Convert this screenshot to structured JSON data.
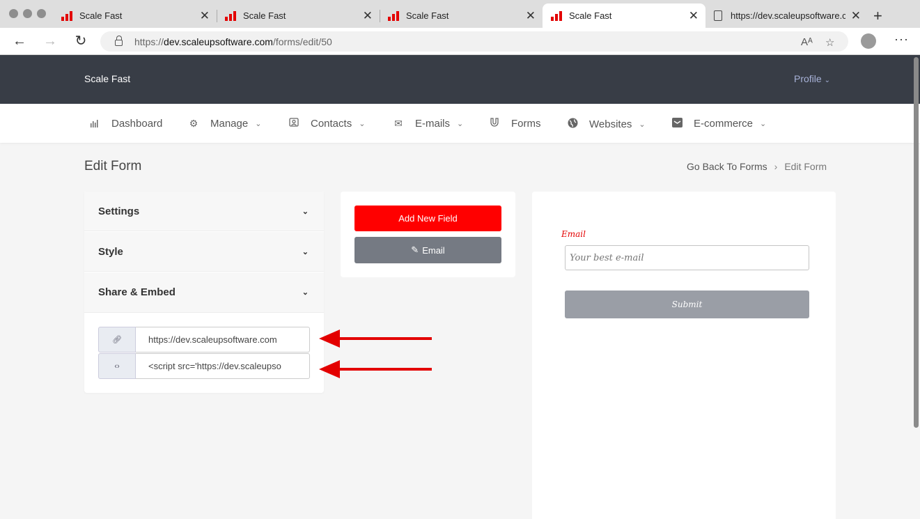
{
  "browser": {
    "tabs": [
      {
        "title": "Scale Fast",
        "active": false
      },
      {
        "title": "Scale Fast",
        "active": false
      },
      {
        "title": "Scale Fast",
        "active": false
      },
      {
        "title": "Scale Fast",
        "active": true
      },
      {
        "title": "https://dev.scaleupsoftware.c",
        "active": false
      }
    ],
    "url_host": "dev.scaleupsoftware.com",
    "url_scheme": "https://",
    "url_path": "/forms/edit/50"
  },
  "app": {
    "brand": "Scale Fast",
    "profile_label": "Profile",
    "menu": [
      {
        "label": "Dashboard",
        "icon": "chart-icon",
        "dropdown": false
      },
      {
        "label": "Manage",
        "icon": "gear-icon",
        "dropdown": true
      },
      {
        "label": "Contacts",
        "icon": "contact-icon",
        "dropdown": true
      },
      {
        "label": "E-mails",
        "icon": "mail-icon",
        "dropdown": true
      },
      {
        "label": "Forms",
        "icon": "magnet-icon",
        "dropdown": false
      },
      {
        "label": "Websites",
        "icon": "globe-icon",
        "dropdown": true
      },
      {
        "label": "E-commerce",
        "icon": "inbox-icon",
        "dropdown": true
      }
    ]
  },
  "page": {
    "title": "Edit Form",
    "breadcrumb": {
      "back": "Go Back To Forms",
      "current": "Edit Form"
    }
  },
  "accordion": {
    "settings": "Settings",
    "style": "Style",
    "share": "Share & Embed",
    "share_link": "https://dev.scaleupsoftware.com",
    "embed_code": "<script src='https://dev.scaleupso"
  },
  "fields": {
    "add_button": "Add New Field",
    "email_button": "Email"
  },
  "preview": {
    "label": "Email",
    "placeholder": "Your best e-mail",
    "submit": "Submit"
  },
  "colors": {
    "accent_red": "#ff0000",
    "topbar": "#383d46",
    "annotation_arrow": "#e30000"
  }
}
